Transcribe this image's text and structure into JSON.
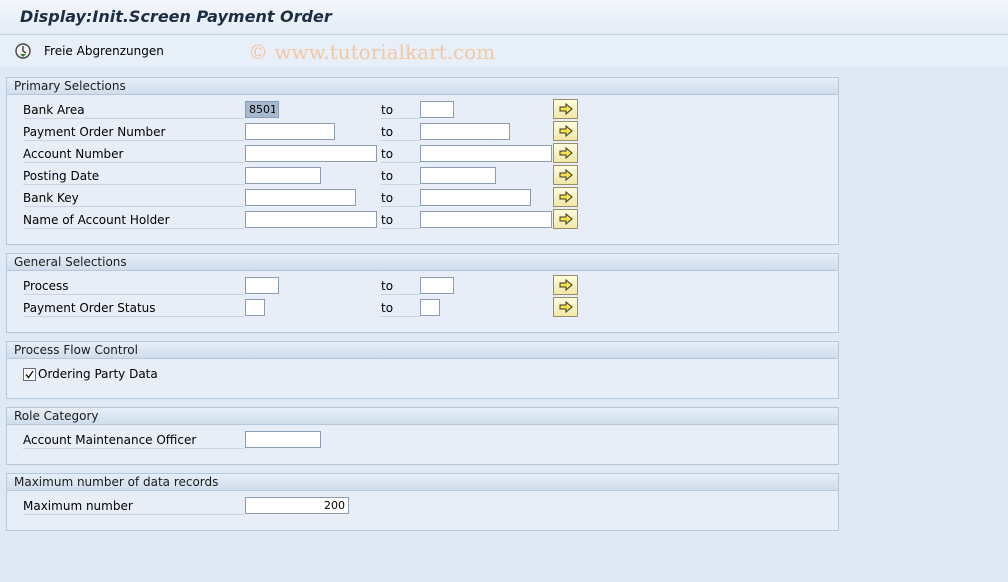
{
  "title": "Display:Init.Screen Payment Order",
  "toolbar": {
    "free_selections_label": "Freie Abgrenzungen",
    "free_selections_icon": "execute-clock-icon"
  },
  "watermark": "© www.tutorialkart.com",
  "to_label": "to",
  "primary": {
    "header": "Primary Selections",
    "rows": [
      {
        "label": "Bank Area",
        "from": "8501",
        "to": ""
      },
      {
        "label": "Payment Order Number",
        "from": "",
        "to": ""
      },
      {
        "label": "Account Number",
        "from": "",
        "to": ""
      },
      {
        "label": "Posting Date",
        "from": "",
        "to": ""
      },
      {
        "label": "Bank Key",
        "from": "",
        "to": ""
      },
      {
        "label": "Name of Account Holder",
        "from": "",
        "to": ""
      }
    ]
  },
  "general": {
    "header": "General Selections",
    "rows": [
      {
        "label": "Process",
        "from": "",
        "to": ""
      },
      {
        "label": "Payment Order Status",
        "from": "",
        "to": ""
      }
    ]
  },
  "process_flow": {
    "header": "Process Flow Control",
    "checkbox_label": "Ordering Party Data",
    "checked": true
  },
  "role": {
    "header": "Role Category",
    "label": "Account Maintenance Officer",
    "value": ""
  },
  "max_records": {
    "header": "Maximum number of data records",
    "label": "Maximum number",
    "value": "200"
  },
  "icons": {
    "multiple_selection": "multiple-selection-arrow-icon"
  },
  "colors": {
    "background": "#dfe9f5",
    "group_header": "#d0ddec",
    "selected_field": "#a7b9cf",
    "button_yellow": "#f1e7a6"
  }
}
